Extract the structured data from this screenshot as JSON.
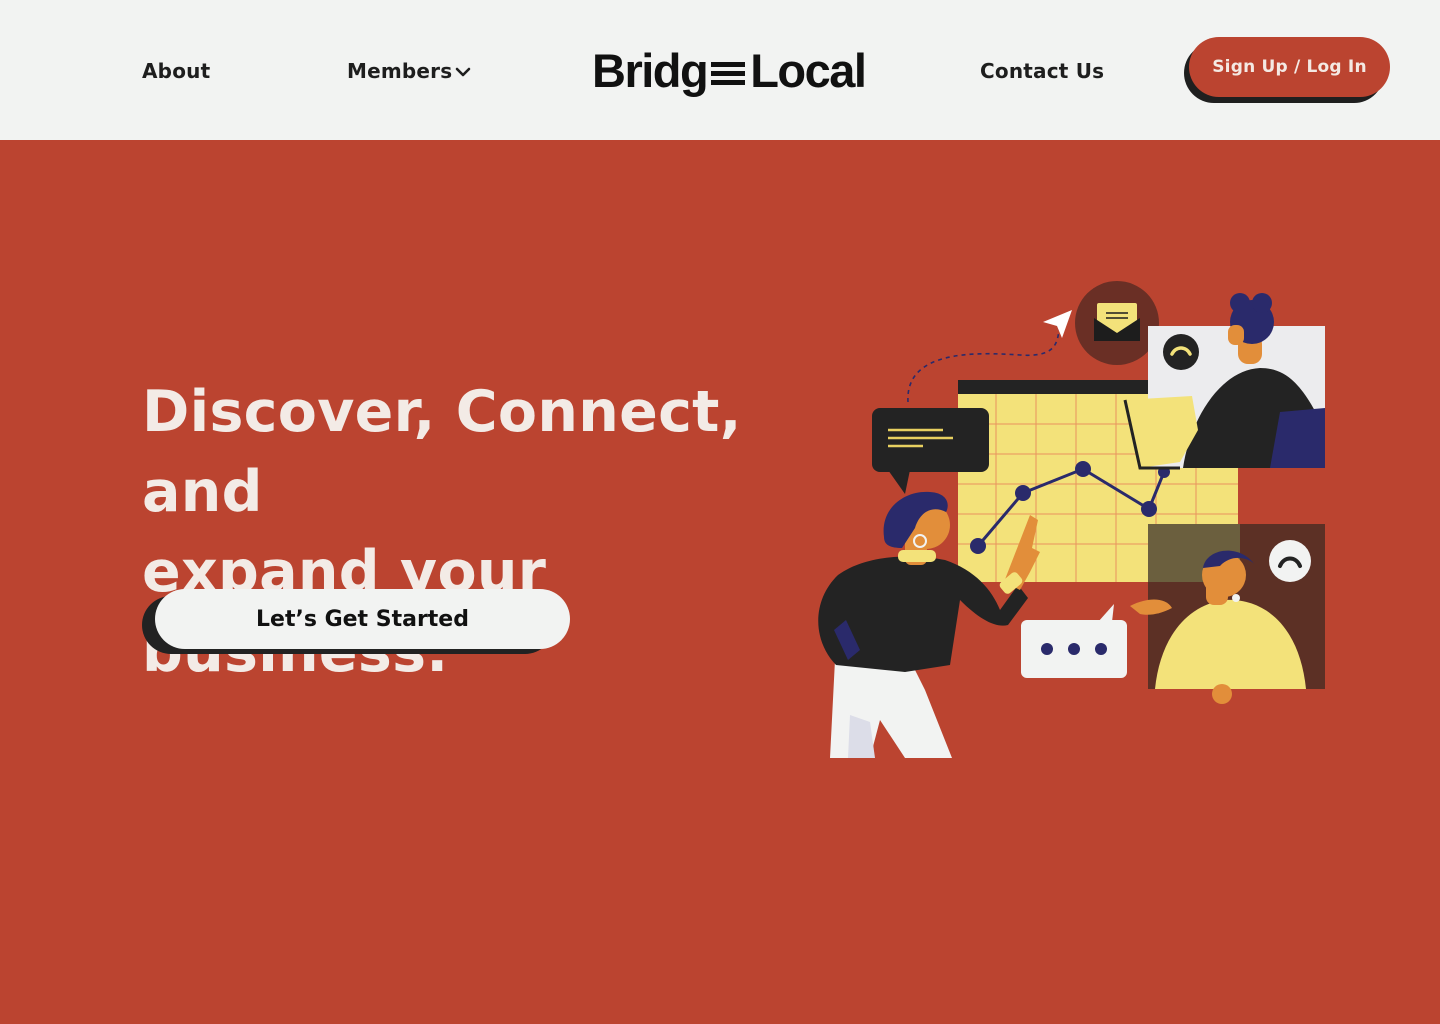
{
  "header": {
    "nav": {
      "about": "About",
      "members": "Members",
      "contact": "Contact Us"
    },
    "logo": {
      "left_text": "Bridg",
      "right_text": "Local"
    },
    "auth_button": "Sign Up / Log In"
  },
  "hero": {
    "title_line1": "Discover, Connect, and",
    "title_line2": "expand your business.",
    "cta": "Let’s Get Started"
  },
  "colors": {
    "brand_red": "#bb4430",
    "header_bg": "#f2f3f2",
    "dark": "#1f1f1f",
    "yellow": "#f3e27a",
    "navy": "#2a2a6b"
  },
  "icons": [
    "chevron-down-icon",
    "paper-plane-icon",
    "envelope-icon",
    "phone-icon",
    "ellipsis-icon"
  ]
}
